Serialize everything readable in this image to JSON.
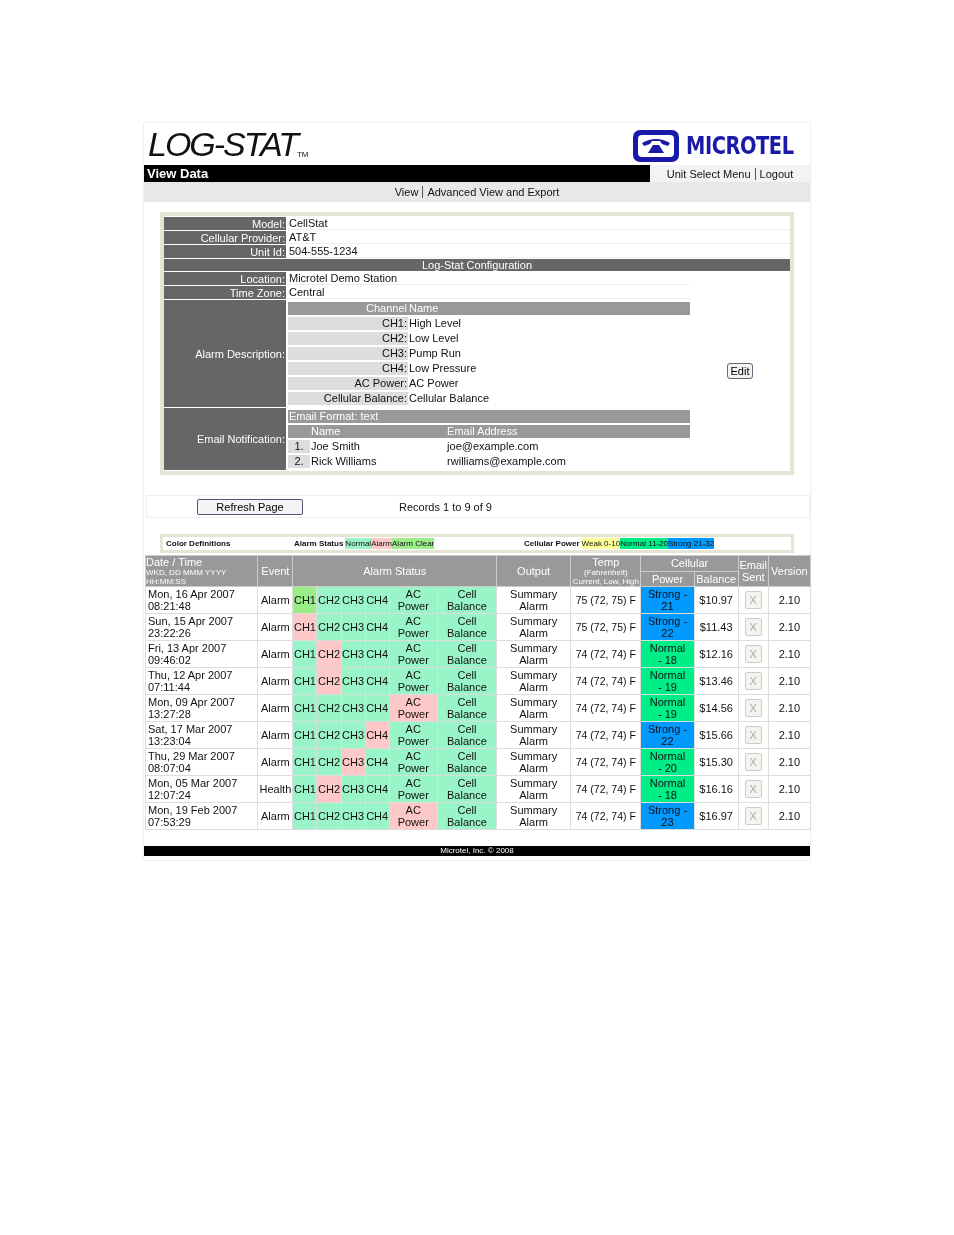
{
  "brand": {
    "logo": "LOG-STAT",
    "trademark": "TM",
    "partner": "MICROTEL"
  },
  "page_title": "View Data",
  "top_links": [
    "Unit Select Menu",
    "Logout"
  ],
  "nav": [
    "View",
    "Advanced View and Export"
  ],
  "unit": [
    {
      "label": "Model:",
      "value": "CellStat"
    },
    {
      "label": "Cellular Provider:",
      "value": "AT&T"
    },
    {
      "label": "Unit Id:",
      "value": "504-555-1234"
    }
  ],
  "config_title": "Log-Stat Configuration",
  "config": [
    {
      "label": "Location:",
      "value": "Microtel Demo Station"
    },
    {
      "label": "Time Zone:",
      "value": "Central"
    }
  ],
  "alarm_description": {
    "label": "Alarm Description:",
    "columns": [
      "Channel",
      "Name"
    ],
    "rows": [
      {
        "channel": "CH1:",
        "name": "High Level"
      },
      {
        "channel": "CH2:",
        "name": "Low Level"
      },
      {
        "channel": "CH3:",
        "name": "Pump Run"
      },
      {
        "channel": "CH4:",
        "name": "Low Pressure"
      },
      {
        "channel": "AC Power:",
        "name": "AC Power"
      },
      {
        "channel": "Cellular Balance:",
        "name": "Cellular Balance"
      }
    ]
  },
  "email_notification": {
    "label": "Email Notification:",
    "format": "Email Format: text",
    "columns": [
      "Name",
      "Email Address"
    ],
    "rows": [
      {
        "index": "1.",
        "name": "Joe Smith",
        "email": "joe@example.com"
      },
      {
        "index": "2.",
        "name": "Rick Williams",
        "email": "rwilliams@example.com"
      }
    ]
  },
  "edit_button": "Edit",
  "refresh_button": "Refresh Page",
  "records": "Records 1 to 9 of 9",
  "legend": {
    "title": "Color Definitions",
    "groups": [
      {
        "label": "Alarm Status",
        "items": [
          {
            "text": "Normal",
            "color": "#99f5c8"
          },
          {
            "text": "Alarm",
            "color": "#ffc8c8"
          },
          {
            "text": "Alarm Clear",
            "color": "#99ee88"
          }
        ]
      },
      {
        "label": "Cellular Power",
        "items": [
          {
            "text": "Weak 0-10",
            "color": "#ffff99"
          },
          {
            "text": "Normal 11-20",
            "color": "#00ee88"
          },
          {
            "text": "Strong 21-32",
            "color": "#0099ff"
          }
        ]
      }
    ]
  },
  "table": {
    "headers": {
      "date": "Date / Time",
      "date_format": "WKD, DD MMM YYYY",
      "time_format": "HH:MM:SS",
      "event": "Event",
      "alarm_status": "Alarm Status",
      "output": "Output",
      "temp": "Temp",
      "temp_unit": "(Fahrenheit)",
      "temp_hint": "Current, Low, High",
      "cellular": "Cellular",
      "power": "Power",
      "balance": "Balance",
      "email_sent": "Email Sent",
      "version": "Version"
    },
    "rows": [
      {
        "date": "Mon, 16 Apr 2007",
        "time": "08:21:48",
        "event": "Alarm",
        "alarms": [
          {
            "label": "CH1",
            "kind": "clear"
          },
          {
            "label": "CH2",
            "kind": "normal"
          },
          {
            "label": "CH3",
            "kind": "normal"
          },
          {
            "label": "CH4",
            "kind": "normal"
          },
          {
            "label": "AC Power",
            "kind": "normal"
          },
          {
            "label": "Cell Balance",
            "kind": "normal"
          }
        ],
        "output": "Summary Alarm",
        "temp": "75 (72, 75) F",
        "power": {
          "text": "Strong - 21",
          "kind": "strong"
        },
        "balance": "$10.97",
        "email_sent": "X",
        "version": "2.10"
      },
      {
        "date": "Sun, 15 Apr 2007",
        "time": "23:22:26",
        "event": "Alarm",
        "alarms": [
          {
            "label": "CH1",
            "kind": "alarm"
          },
          {
            "label": "CH2",
            "kind": "normal"
          },
          {
            "label": "CH3",
            "kind": "normal"
          },
          {
            "label": "CH4",
            "kind": "normal"
          },
          {
            "label": "AC Power",
            "kind": "normal"
          },
          {
            "label": "Cell Balance",
            "kind": "normal"
          }
        ],
        "output": "Summary Alarm",
        "temp": "75 (72, 75) F",
        "power": {
          "text": "Strong - 22",
          "kind": "strong"
        },
        "balance": "$11.43",
        "email_sent": "X",
        "version": "2.10"
      },
      {
        "date": "Fri, 13 Apr 2007",
        "time": "09:46:02",
        "event": "Alarm",
        "alarms": [
          {
            "label": "CH1",
            "kind": "normal"
          },
          {
            "label": "CH2",
            "kind": "alarm"
          },
          {
            "label": "CH3",
            "kind": "normal"
          },
          {
            "label": "CH4",
            "kind": "normal"
          },
          {
            "label": "AC Power",
            "kind": "normal"
          },
          {
            "label": "Cell Balance",
            "kind": "normal"
          }
        ],
        "output": "Summary Alarm",
        "temp": "74 (72, 74) F",
        "power": {
          "text": "Normal - 18",
          "kind": "normal"
        },
        "balance": "$12.16",
        "email_sent": "X",
        "version": "2.10"
      },
      {
        "date": "Thu, 12 Apr 2007",
        "time": "07:11:44",
        "event": "Alarm",
        "alarms": [
          {
            "label": "CH1",
            "kind": "normal"
          },
          {
            "label": "CH2",
            "kind": "alarm"
          },
          {
            "label": "CH3",
            "kind": "normal"
          },
          {
            "label": "CH4",
            "kind": "normal"
          },
          {
            "label": "AC Power",
            "kind": "normal"
          },
          {
            "label": "Cell Balance",
            "kind": "normal"
          }
        ],
        "output": "Summary Alarm",
        "temp": "74 (72, 74) F",
        "power": {
          "text": "Normal - 19",
          "kind": "normal"
        },
        "balance": "$13.46",
        "email_sent": "X",
        "version": "2.10"
      },
      {
        "date": "Mon, 09 Apr 2007",
        "time": "13:27:28",
        "event": "Alarm",
        "alarms": [
          {
            "label": "CH1",
            "kind": "normal"
          },
          {
            "label": "CH2",
            "kind": "normal"
          },
          {
            "label": "CH3",
            "kind": "normal"
          },
          {
            "label": "CH4",
            "kind": "normal"
          },
          {
            "label": "AC Power",
            "kind": "alarm"
          },
          {
            "label": "Cell Balance",
            "kind": "normal"
          }
        ],
        "output": "Summary Alarm",
        "temp": "74 (72, 74) F",
        "power": {
          "text": "Normal - 19",
          "kind": "normal"
        },
        "balance": "$14.56",
        "email_sent": "X",
        "version": "2.10"
      },
      {
        "date": "Sat, 17 Mar 2007",
        "time": "13:23:04",
        "event": "Alarm",
        "alarms": [
          {
            "label": "CH1",
            "kind": "normal"
          },
          {
            "label": "CH2",
            "kind": "normal"
          },
          {
            "label": "CH3",
            "kind": "normal"
          },
          {
            "label": "CH4",
            "kind": "alarm"
          },
          {
            "label": "AC Power",
            "kind": "normal"
          },
          {
            "label": "Cell Balance",
            "kind": "normal"
          }
        ],
        "output": "Summary Alarm",
        "temp": "74 (72, 74) F",
        "power": {
          "text": "Strong - 22",
          "kind": "strong"
        },
        "balance": "$15.66",
        "email_sent": "X",
        "version": "2.10"
      },
      {
        "date": "Thu, 29 Mar 2007",
        "time": "08:07:04",
        "event": "Alarm",
        "alarms": [
          {
            "label": "CH1",
            "kind": "normal"
          },
          {
            "label": "CH2",
            "kind": "normal"
          },
          {
            "label": "CH3",
            "kind": "alarm"
          },
          {
            "label": "CH4",
            "kind": "normal"
          },
          {
            "label": "AC Power",
            "kind": "normal"
          },
          {
            "label": "Cell Balance",
            "kind": "normal"
          }
        ],
        "output": "Summary Alarm",
        "temp": "74 (72, 74) F",
        "power": {
          "text": "Normal - 20",
          "kind": "normal"
        },
        "balance": "$15.30",
        "email_sent": "X",
        "version": "2.10"
      },
      {
        "date": "Mon, 05 Mar 2007",
        "time": "12:07:24",
        "event": "Health",
        "alarms": [
          {
            "label": "CH1",
            "kind": "normal"
          },
          {
            "label": "CH2",
            "kind": "alarm"
          },
          {
            "label": "CH3",
            "kind": "normal"
          },
          {
            "label": "CH4",
            "kind": "normal"
          },
          {
            "label": "AC Power",
            "kind": "normal"
          },
          {
            "label": "Cell Balance",
            "kind": "normal"
          }
        ],
        "output": "Summary Alarm",
        "temp": "74 (72, 74) F",
        "power": {
          "text": "Normal - 18",
          "kind": "normal"
        },
        "balance": "$16.16",
        "email_sent": "X",
        "version": "2.10"
      },
      {
        "date": "Mon, 19 Feb 2007",
        "time": "07:53:29",
        "event": "Alarm",
        "alarms": [
          {
            "label": "CH1",
            "kind": "normal"
          },
          {
            "label": "CH2",
            "kind": "normal"
          },
          {
            "label": "CH3",
            "kind": "normal"
          },
          {
            "label": "CH4",
            "kind": "normal"
          },
          {
            "label": "AC Power",
            "kind": "alarm"
          },
          {
            "label": "Cell Balance",
            "kind": "normal"
          }
        ],
        "output": "Summary Alarm",
        "temp": "74 (72, 74) F",
        "power": {
          "text": "Strong - 23",
          "kind": "strong"
        },
        "balance": "$16.97",
        "email_sent": "X",
        "version": "2.10"
      }
    ]
  },
  "footer": "Microtel, Inc. © 2008"
}
